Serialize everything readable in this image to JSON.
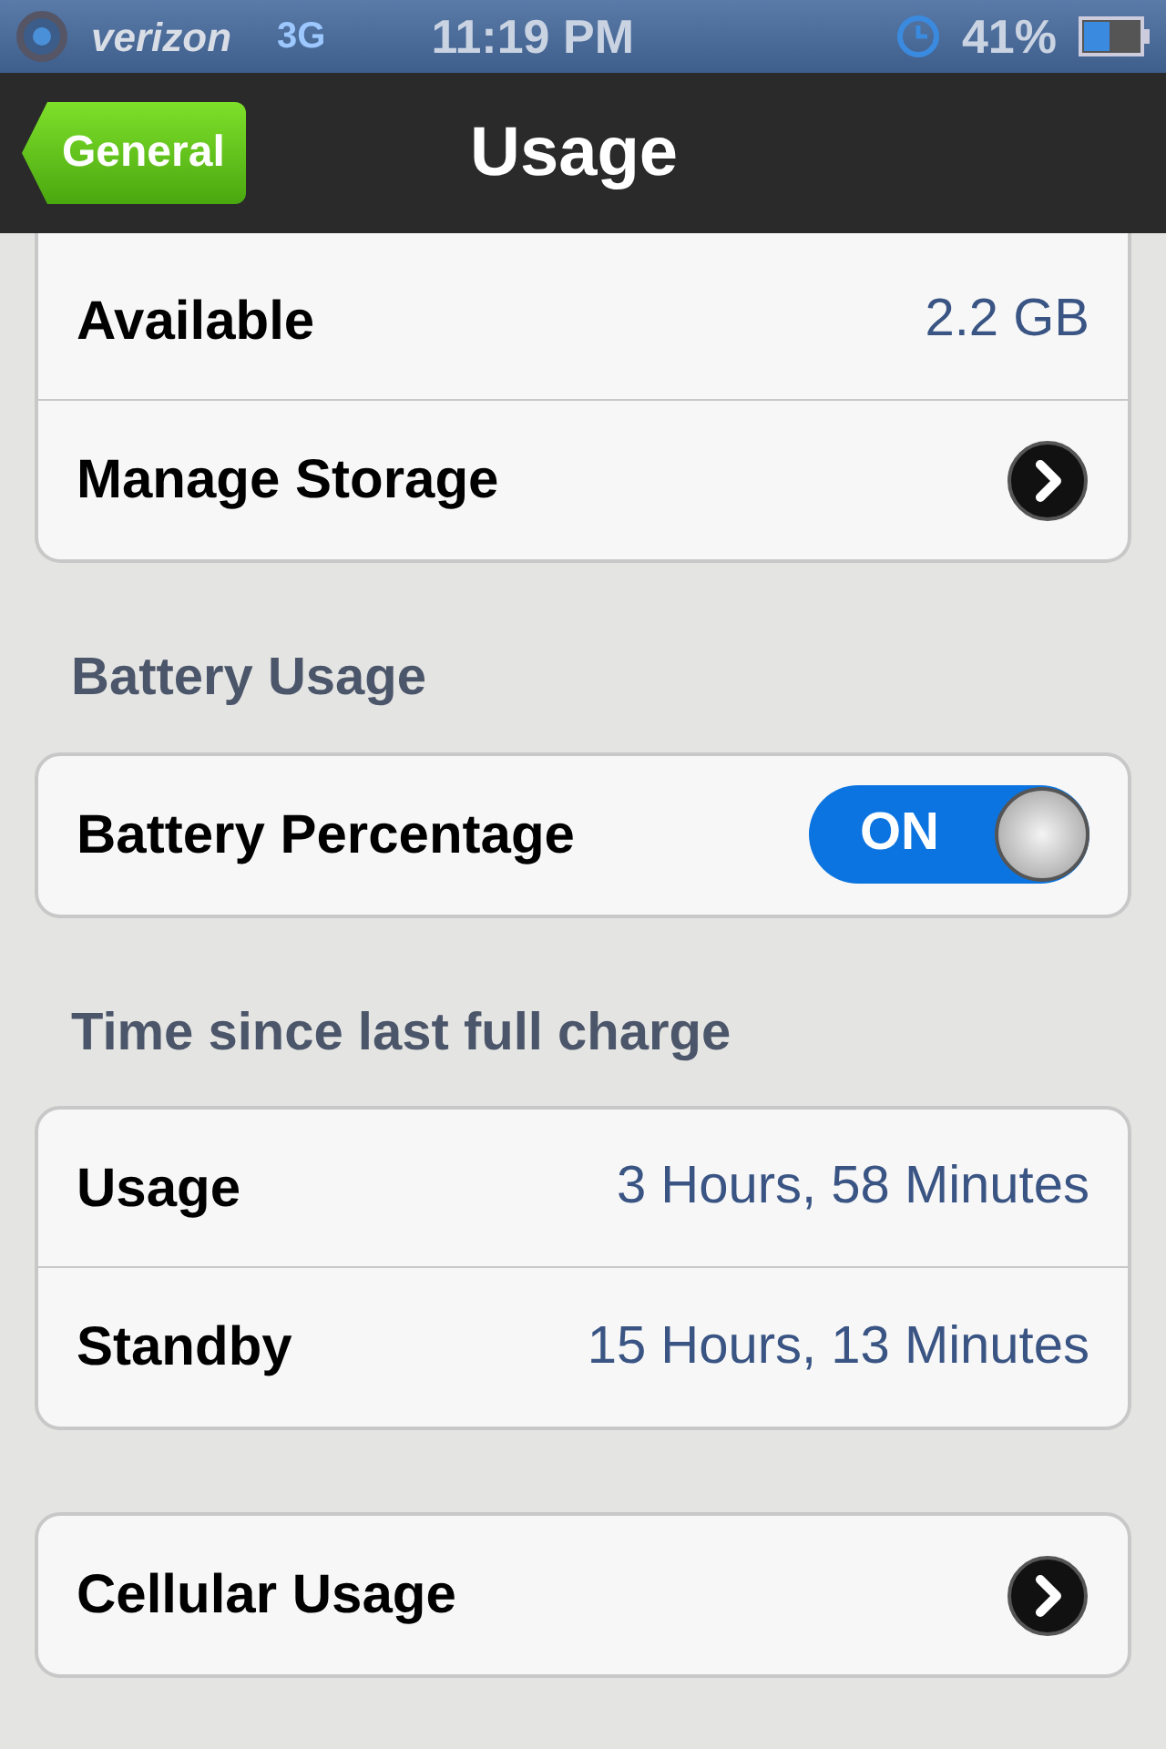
{
  "status_bar": {
    "carrier": "verizon",
    "network": "3G",
    "time": "11:19 PM",
    "battery": "41%"
  },
  "nav_bar": {
    "back": "General",
    "title": "Usage"
  },
  "sections": [
    {
      "cut_top": true,
      "rows": [
        {
          "kind": "value",
          "label": "Available",
          "value": "2.2 GB"
        },
        {
          "kind": "disclosure",
          "label": "Manage Storage"
        }
      ]
    },
    {
      "header": "Battery Usage",
      "rows": [
        {
          "kind": "switch",
          "label": "Battery Percentage",
          "on": true,
          "on_text": "ON"
        }
      ]
    },
    {
      "header": "Time since last full charge",
      "rows": [
        {
          "kind": "value",
          "label": "Usage",
          "value": "3 Hours, 58 Minutes"
        },
        {
          "kind": "value",
          "label": "Standby",
          "value": "15 Hours, 13 Minutes"
        }
      ]
    },
    {
      "rows": [
        {
          "kind": "disclosure",
          "label": "Cellular Usage"
        }
      ]
    }
  ]
}
